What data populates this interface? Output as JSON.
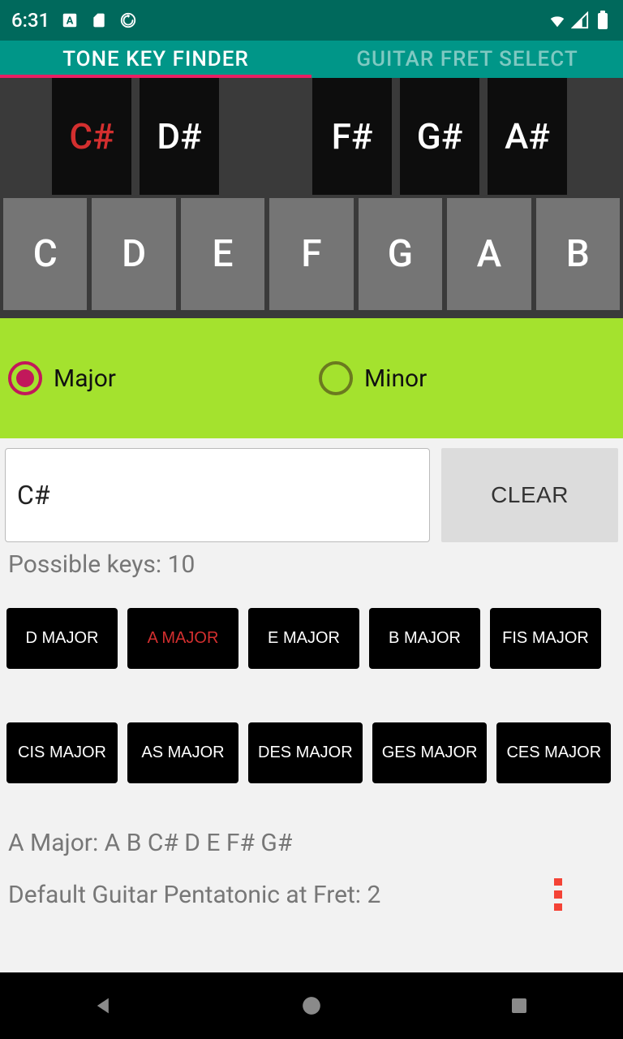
{
  "status": {
    "time": "6:31"
  },
  "tabs": {
    "active": "TONE KEY FINDER",
    "inactive": "GUITAR FRET SELECT"
  },
  "piano": {
    "blacks": [
      "C#",
      "D#",
      "F#",
      "G#",
      "A#"
    ],
    "whites": [
      "C",
      "D",
      "E",
      "F",
      "G",
      "A",
      "B"
    ],
    "selected": "C#"
  },
  "modes": {
    "major": "Major",
    "minor": "Minor"
  },
  "input": {
    "value": "C#",
    "clear": "CLEAR"
  },
  "possible": "Possible keys: 10",
  "keys": [
    "D MAJOR",
    "A MAJOR",
    "E MAJOR",
    "B MAJOR",
    "FIS MAJOR",
    "CIS MAJOR",
    "AS MAJOR",
    "DES MAJOR",
    "GES MAJOR",
    "CES MAJOR"
  ],
  "selectedKey": "A MAJOR",
  "scale": "A Major: A B C# D E F# G#",
  "pentatonic": "Default Guitar Pentatonic at Fret: 2"
}
